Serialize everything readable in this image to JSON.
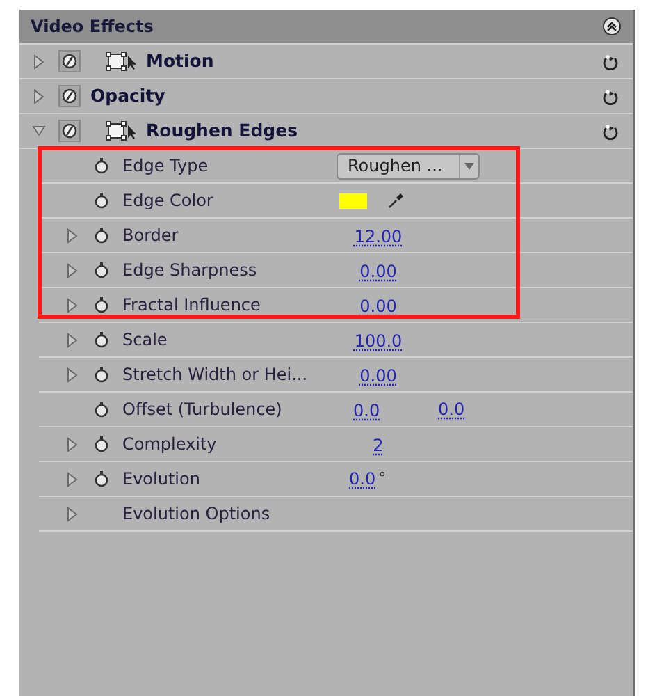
{
  "panel": {
    "title": "Video Effects"
  },
  "effects": [
    {
      "name": "Motion",
      "kind": "transform",
      "expanded": false
    },
    {
      "name": "Opacity",
      "kind": "plain",
      "expanded": false
    },
    {
      "name": "Roughen Edges",
      "kind": "transform",
      "expanded": true,
      "params": [
        {
          "name": "Edge Type",
          "kind": "dropdown",
          "expandable": false,
          "animatable": true,
          "highlighted": true,
          "value": "Roughen ..."
        },
        {
          "name": "Edge Color",
          "kind": "color",
          "expandable": false,
          "animatable": true,
          "highlighted": true,
          "color": "#ffff00"
        },
        {
          "name": "Border",
          "kind": "number",
          "expandable": true,
          "animatable": true,
          "highlighted": true,
          "value": "12.00"
        },
        {
          "name": "Edge Sharpness",
          "kind": "number",
          "expandable": true,
          "animatable": true,
          "highlighted": true,
          "value": "0.00"
        },
        {
          "name": "Fractal Influence",
          "kind": "number",
          "expandable": true,
          "animatable": true,
          "highlighted": true,
          "value": "0.00"
        },
        {
          "name": "Scale",
          "kind": "number",
          "expandable": true,
          "animatable": true,
          "highlighted": false,
          "value": "100.0"
        },
        {
          "name": "Stretch Width or Hei...",
          "kind": "number",
          "expandable": true,
          "animatable": true,
          "highlighted": false,
          "value": "0.00"
        },
        {
          "name": "Offset (Turbulence)",
          "kind": "point",
          "expandable": false,
          "animatable": true,
          "highlighted": false,
          "values": [
            "0.0",
            "0.0"
          ]
        },
        {
          "name": "Complexity",
          "kind": "number",
          "expandable": true,
          "animatable": true,
          "highlighted": false,
          "value": "2"
        },
        {
          "name": "Evolution",
          "kind": "angle",
          "expandable": true,
          "animatable": true,
          "highlighted": false,
          "value": "0.0",
          "unit": "°"
        },
        {
          "name": "Evolution Options",
          "kind": "group",
          "expandable": true,
          "animatable": false,
          "highlighted": false
        }
      ]
    }
  ]
}
